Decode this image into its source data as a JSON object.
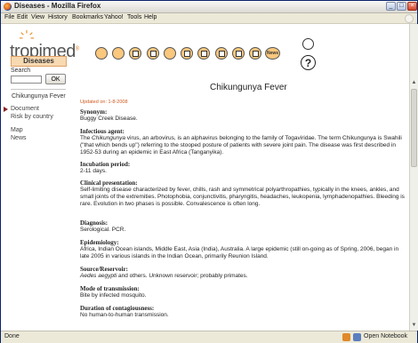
{
  "window": {
    "title": "Diseases - Mozilla Firefox"
  },
  "menu": [
    "File",
    "Edit",
    "View",
    "History",
    "Bookmarks",
    "Yahoo!",
    "Tools",
    "Help"
  ],
  "sidebar": {
    "logo_text": "tropimed",
    "logo_mark": "®",
    "section_button": "Diseases",
    "search_label": "Search",
    "search_value": "",
    "ok_label": "OK",
    "disease_name": "Chikungunya Fever",
    "nav": [
      "Document",
      "Risk by country",
      "Map",
      "News"
    ]
  },
  "toolbar": {
    "icons": [
      "globe-icon",
      "syringe-icon",
      "pill-icon",
      "calendar-icon",
      "mountain-icon",
      "document-icon",
      "map-icon",
      "house-icon",
      "mosquito-icon",
      "notes-icon",
      "news-icon"
    ],
    "news_label": "News",
    "print_icon": "print-icon",
    "help_label": "?"
  },
  "article": {
    "title": "Chikungunya Fever",
    "updated": "Updated on: 1-8-2008",
    "sections": [
      {
        "heading": "Synonym:",
        "body": "Buggy Creek Disease."
      },
      {
        "heading": "Infectious agent:",
        "body_parts": [
          "The ",
          "Chikungunya",
          " virus, an arbovirus, is an alphavirus belonging to the family of Togaviridae. The term Chikungunya is Swahili (\"that which bends up\") referring to the stooped posture of patients with severe joint pain. The disease was first described in 1952-53 during an epidemic in East Africa (Tanganyika)."
        ]
      },
      {
        "heading": "Incubation period:",
        "body": "2-11 days."
      },
      {
        "heading": "Clinical presentation:",
        "body": "Self-limiting disease characterized by fever, chills, rash and symmetrical polyarthropathies, typically in the knees, ankles, and small joints of the extremities. Photophobia, conjunctivitis, pharyngitis, headaches, leukopenia, lymphadenopathies. Bleeding is rare. Evolution in two phases is possible. Convalescence is often long."
      },
      {
        "heading": "Diagnosis:",
        "body": "Serological. PCR."
      },
      {
        "heading": "Epidemiology:",
        "body": "Africa, Indian Ocean islands, Middle East, Asia (India), Australia. A large epidemic (still on-going as of Spring, 2006, began in late 2005 in various islands in the Indian Ocean, primarily Reunion Island."
      },
      {
        "heading": "Source/Reservoir:",
        "body_parts": [
          "",
          "Aedes aegypti",
          " and others. Unknown reservoir; probably primates."
        ]
      },
      {
        "heading": "Mode of transmission:",
        "body": "Bite by infected mosquito."
      },
      {
        "heading": "Duration of contagiousness:",
        "body": "No human-to-human transmission."
      }
    ]
  },
  "status": {
    "text": "Done",
    "notebook": "Open Notebook"
  },
  "colors": {
    "accent": "#d2581c",
    "button_bg": "#f7d9b2",
    "icon_fill": "#f9c77d"
  }
}
